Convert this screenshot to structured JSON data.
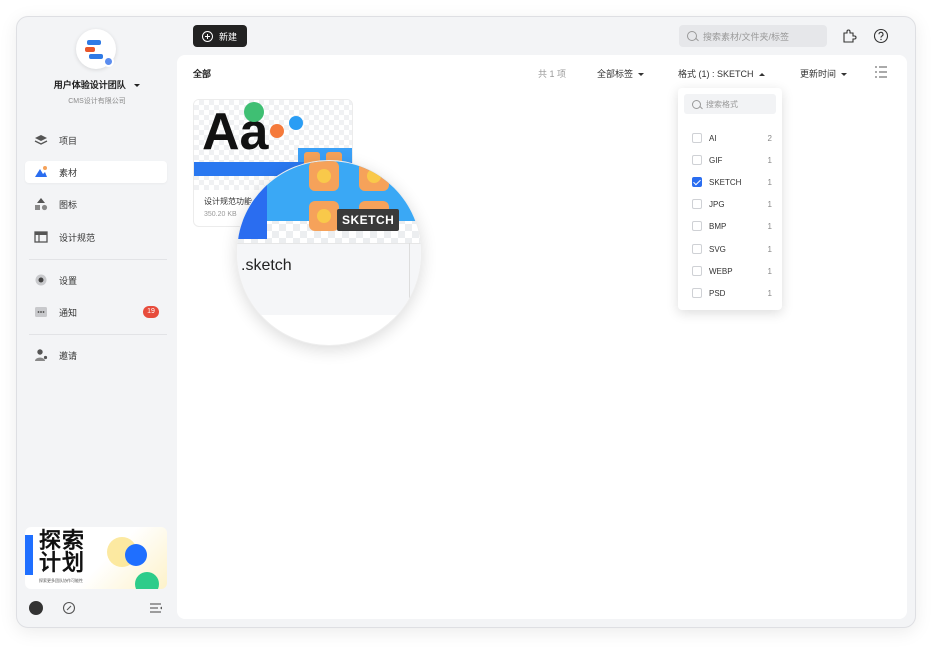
{
  "sidebar": {
    "team_name": "用户体验设计团队",
    "team_sub": "CMS设计有限公司",
    "items": [
      {
        "label": "项目",
        "icon": "layers-icon"
      },
      {
        "label": "素材",
        "icon": "mountain-icon",
        "active": true
      },
      {
        "label": "图标",
        "icon": "shapes-icon"
      },
      {
        "label": "设计规范",
        "icon": "table-icon"
      },
      {
        "label": "设置",
        "icon": "gear-icon"
      },
      {
        "label": "通知",
        "icon": "message-icon",
        "badge": "19"
      },
      {
        "label": "邀请",
        "icon": "user-plus-icon"
      }
    ],
    "promo": {
      "title_line1": "探索",
      "title_line2": "计划",
      "subtitle": "探索更多团队协作可能性"
    }
  },
  "toolbar": {
    "new_label": "新建",
    "search_placeholder": "搜索素材/文件夹/标签"
  },
  "main": {
    "breadcrumb": "全部",
    "count": "共 1 项",
    "tag_filter": "全部标签",
    "format_filter": "格式 (1) : SKETCH",
    "sort": "更新时间"
  },
  "card": {
    "thumb_text": "Aa",
    "name": "设计规范功能",
    "size": "350.20 KB"
  },
  "magnifier": {
    "tag": "SKETCH",
    "filename": ".sketch"
  },
  "dropdown": {
    "placeholder": "搜索格式",
    "options": [
      {
        "label": "AI",
        "count": "2",
        "checked": false
      },
      {
        "label": "GIF",
        "count": "1",
        "checked": false
      },
      {
        "label": "SKETCH",
        "count": "1",
        "checked": true
      },
      {
        "label": "JPG",
        "count": "1",
        "checked": false
      },
      {
        "label": "BMP",
        "count": "1",
        "checked": false
      },
      {
        "label": "SVG",
        "count": "1",
        "checked": false
      },
      {
        "label": "WEBP",
        "count": "1",
        "checked": false
      },
      {
        "label": "PSD",
        "count": "1",
        "checked": false
      }
    ]
  },
  "colors": {
    "accent": "#2a6df0",
    "badge": "#e74c3c",
    "button_dark": "#222222"
  }
}
